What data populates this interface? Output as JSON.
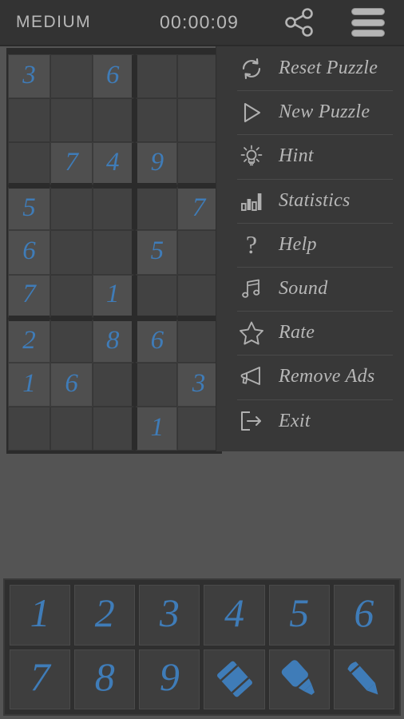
{
  "header": {
    "difficulty": "MEDIUM",
    "timer": "00:00:09",
    "share_icon": "share-icon",
    "menu_icon": "hamburger-menu-icon"
  },
  "colors": {
    "background": "#545454",
    "header_bg": "#333333",
    "board_bg": "#2b2b2b",
    "cell_empty": "#424242",
    "cell_filled": "#4f4f4f",
    "number_blue": "#3f7cb8",
    "menu_bg": "#383838",
    "menu_text": "#b7b7b7",
    "header_text": "#b8b8b8",
    "numpad_bg": "#2f2f2f",
    "numpad_btn": "#3e3e3e"
  },
  "board": {
    "rows": [
      [
        "3",
        "",
        "6",
        "",
        "",
        "",
        "",
        "",
        ""
      ],
      [
        "",
        "",
        "",
        "",
        "",
        "",
        "",
        "",
        ""
      ],
      [
        "",
        "7",
        "4",
        "9",
        "",
        "",
        "",
        "",
        ""
      ],
      [
        "5",
        "",
        "",
        "",
        "7",
        "",
        "",
        "",
        ""
      ],
      [
        "6",
        "",
        "",
        "5",
        "",
        "",
        "",
        "",
        ""
      ],
      [
        "7",
        "",
        "1",
        "",
        "",
        "",
        "",
        "",
        ""
      ],
      [
        "2",
        "",
        "8",
        "6",
        "",
        "",
        "",
        "",
        ""
      ],
      [
        "1",
        "6",
        "",
        "",
        "3",
        "",
        "",
        "",
        ""
      ],
      [
        "",
        "",
        "",
        "1",
        "",
        "",
        "",
        "",
        ""
      ]
    ]
  },
  "menu": {
    "items": [
      {
        "label": "Reset Puzzle",
        "icon": "reset-icon"
      },
      {
        "label": "New Puzzle",
        "icon": "play-triangle-icon"
      },
      {
        "label": "Hint",
        "icon": "lightbulb-icon"
      },
      {
        "label": "Statistics",
        "icon": "bar-chart-icon"
      },
      {
        "label": "Help",
        "icon": "question-mark-icon"
      },
      {
        "label": "Sound",
        "icon": "music-note-icon"
      },
      {
        "label": "Rate",
        "icon": "star-icon"
      },
      {
        "label": "Remove Ads",
        "icon": "megaphone-icon"
      },
      {
        "label": "Exit",
        "icon": "exit-arrow-icon"
      }
    ]
  },
  "numpad": {
    "keys": [
      {
        "label": "1",
        "icon": null
      },
      {
        "label": "2",
        "icon": null
      },
      {
        "label": "3",
        "icon": null
      },
      {
        "label": "4",
        "icon": null
      },
      {
        "label": "5",
        "icon": null
      },
      {
        "label": "6",
        "icon": null
      },
      {
        "label": "7",
        "icon": null
      },
      {
        "label": "8",
        "icon": null
      },
      {
        "label": "9",
        "icon": null
      },
      {
        "label": "",
        "icon": "eraser-icon"
      },
      {
        "label": "",
        "icon": "highlighter-icon"
      },
      {
        "label": "",
        "icon": "pencil-icon"
      }
    ]
  }
}
